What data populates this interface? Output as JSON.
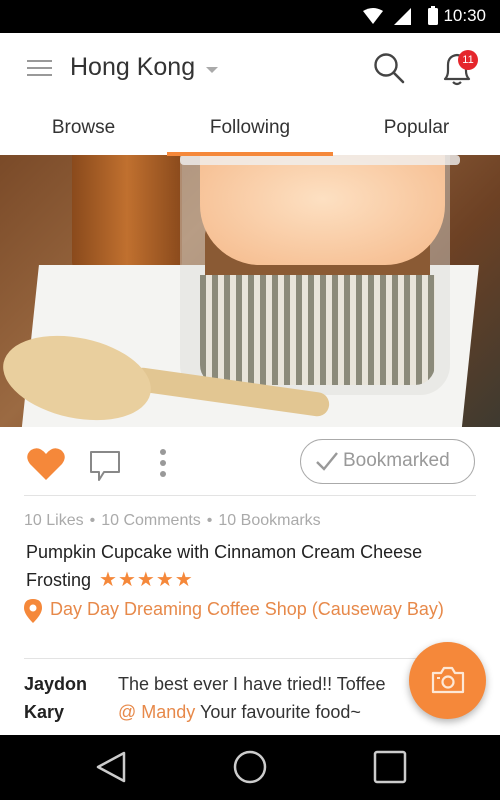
{
  "status_bar": {
    "time": "10:30",
    "icons": [
      "wifi-icon",
      "signal-icon",
      "battery-icon"
    ]
  },
  "app_bar": {
    "menu_icon": "hamburger-menu-icon",
    "city": "Hong Kong",
    "city_dropdown_icon": "caret-down-icon",
    "search_icon": "search-icon",
    "notifications_icon": "bell-icon",
    "notifications_count": "11"
  },
  "tabs": [
    {
      "label": "Browse",
      "active": false
    },
    {
      "label": "Following",
      "active": true
    },
    {
      "label": "Popular",
      "active": false
    }
  ],
  "post": {
    "photo_alt": "Pumpkin cupcake with cream cheese frosting in a plastic cup with a wooden spoon",
    "liked": true,
    "bookmark_label": "Bookmarked",
    "stats": {
      "likes": "10 Likes",
      "comments": "10 Comments",
      "bookmarks": "10 Bookmarks",
      "separator": "•"
    },
    "title": "Pumpkin Cupcake with Cinnamon Cream Cheese Frosting",
    "rating": 5,
    "rating_max": 5,
    "stars": "★★★★★",
    "location": "Day Day Dreaming Coffee Shop (Causeway Bay)",
    "comments": [
      {
        "author": "Jaydon",
        "mention": "",
        "text": "The best ever I have tried!! Toffee"
      },
      {
        "author": "Kary",
        "mention": "@ Mandy",
        "text": " Your favourite food~"
      }
    ]
  },
  "fab": {
    "icon": "camera-icon"
  },
  "colors": {
    "accent": "#f5883a",
    "location_text": "#e7894a",
    "badge": "#e5262c"
  },
  "nav_bar": [
    "back-icon",
    "home-icon",
    "recents-icon"
  ]
}
